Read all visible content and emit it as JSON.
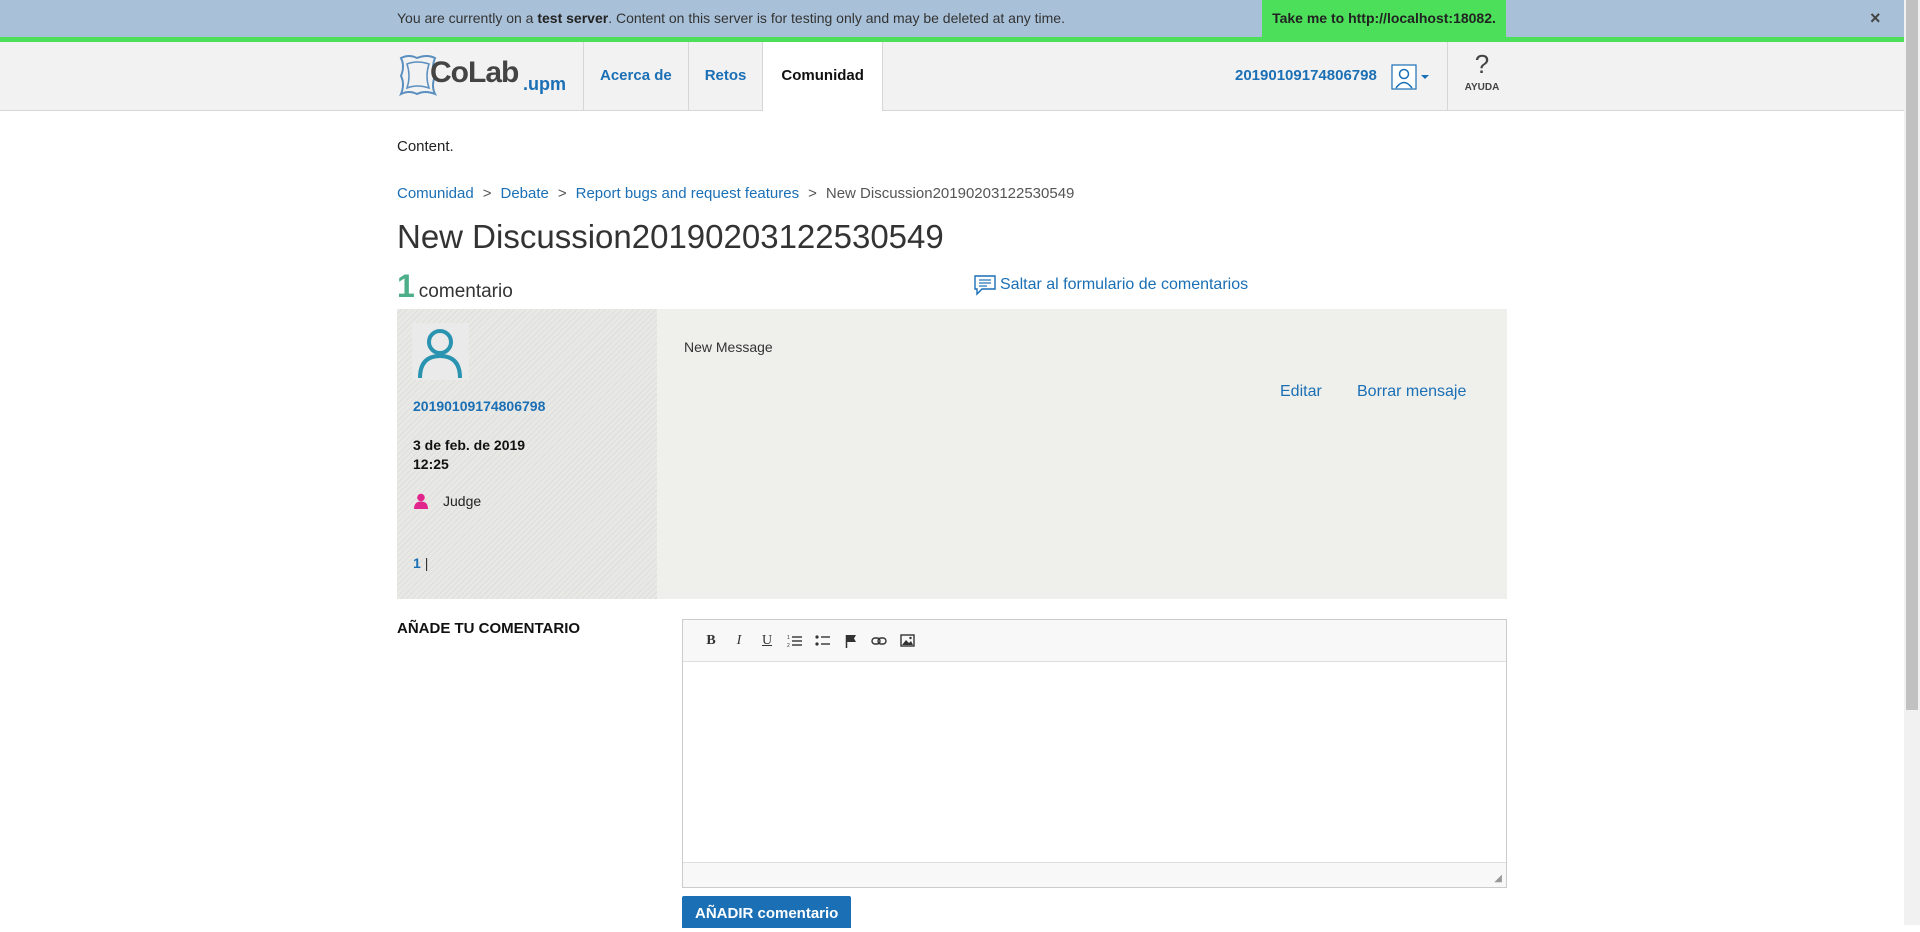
{
  "banner": {
    "text_prefix": "You are currently on a ",
    "text_bold": "test server",
    "text_suffix": ". Content on this server is for testing only and may be deleted at any time.",
    "link_label": "Take me to http://localhost:18082.",
    "close_label": "×"
  },
  "header": {
    "logo_main": "CoLab",
    "logo_sub": ".upm",
    "nav": [
      {
        "label": "Acerca de"
      },
      {
        "label": "Retos"
      },
      {
        "label": "Comunidad"
      }
    ],
    "user_name": "20190109174806798",
    "help_symbol": "?",
    "help_label": "AYUDA"
  },
  "page": {
    "content_text": "Content.",
    "breadcrumb": [
      {
        "label": "Comunidad"
      },
      {
        "label": "Debate"
      },
      {
        "label": "Report bugs and request features"
      },
      {
        "label": "New Discussion20190203122530549"
      }
    ],
    "breadcrumb_sep": ">",
    "title": "New Discussion20190203122530549",
    "comment_count": "1",
    "comment_count_label": "comentario",
    "jump_link": "Saltar al formulario de comentarios"
  },
  "comment": {
    "author": "20190109174806798",
    "date": "3 de feb. de 2019",
    "time": "12:25",
    "role": "Judge",
    "page_num": "1",
    "page_sep": "|",
    "body": "New Message",
    "edit_label": "Editar",
    "delete_label": "Borrar mensaje"
  },
  "add_comment": {
    "label": "AÑADE TU COMENTARIO",
    "toolbar": [
      {
        "icon": "bold-icon",
        "glyph": "B"
      },
      {
        "icon": "italic-icon",
        "glyph": "I"
      },
      {
        "icon": "underline-icon",
        "glyph": "U"
      },
      {
        "icon": "numbered-list-icon",
        "glyph": "≡"
      },
      {
        "icon": "bullet-list-icon",
        "glyph": "≡"
      },
      {
        "icon": "flag-icon",
        "glyph": "⚑"
      },
      {
        "icon": "link-icon",
        "glyph": "∞"
      },
      {
        "icon": "image-icon",
        "glyph": "▣"
      }
    ],
    "resize_glyph": "◢",
    "submit_label": "AÑADIR comentario"
  },
  "colors": {
    "accent": "#1a6fb5",
    "banner_bg": "#a8c0d8",
    "banner_green": "#4ce05a",
    "count_green": "#4caf8a",
    "role_pink": "#e0268c"
  }
}
